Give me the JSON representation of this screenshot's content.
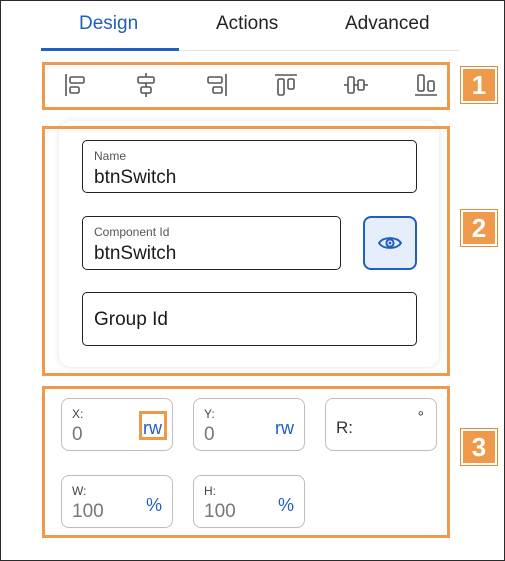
{
  "tabs": [
    {
      "label": "Design",
      "active": true
    },
    {
      "label": "Actions",
      "active": false
    },
    {
      "label": "Advanced",
      "active": false
    }
  ],
  "toolbar": {
    "icons": [
      "align-left-icon",
      "align-center-horizontal-icon",
      "align-right-icon",
      "align-top-icon",
      "align-center-vertical-icon",
      "align-bottom-icon"
    ]
  },
  "badges": [
    "1",
    "2",
    "3"
  ],
  "identity": {
    "name": {
      "label": "Name",
      "value": "btnSwitch"
    },
    "component_id": {
      "label": "Component Id",
      "value": "btnSwitch"
    },
    "group_id": {
      "placeholder": "Group Id"
    },
    "visibility_icon": "eye-icon"
  },
  "geometry": {
    "x": {
      "label": "X:",
      "value": "0",
      "unit": "rw"
    },
    "y": {
      "label": "Y:",
      "value": "0",
      "unit": "rw"
    },
    "r": {
      "label": "R:",
      "unit": "°"
    },
    "w": {
      "label": "W:",
      "value": "100",
      "unit": "%"
    },
    "h": {
      "label": "H:",
      "value": "100",
      "unit": "%"
    }
  },
  "colors": {
    "accent": "#1f5fbf",
    "highlight": "#ef9a4a",
    "eye_button_bg": "#e6eefb"
  }
}
